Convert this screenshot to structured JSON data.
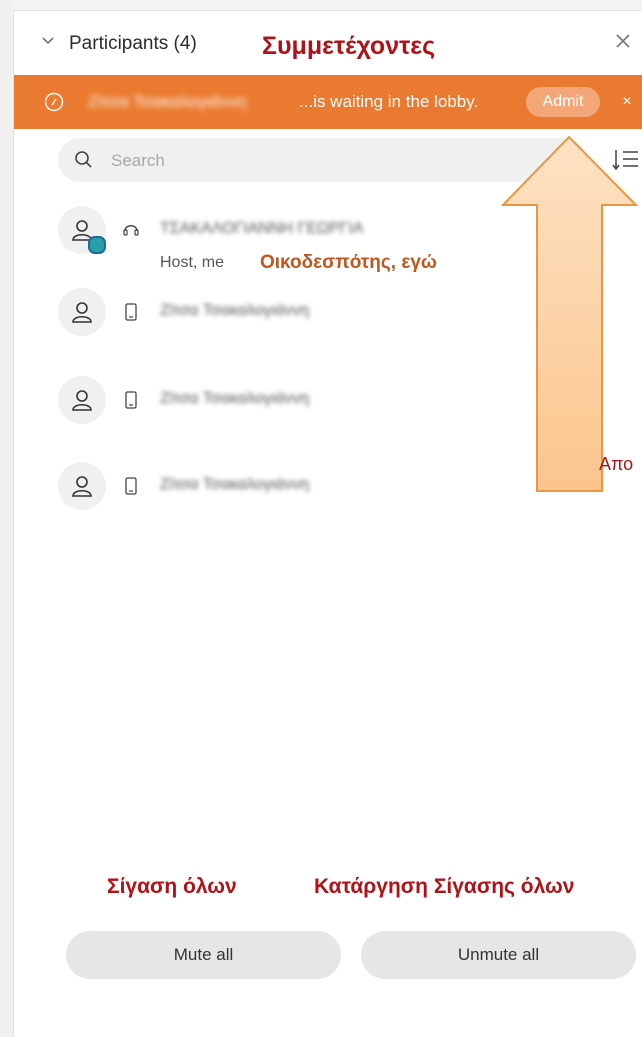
{
  "header": {
    "title": "Participants (4)",
    "greek_title": "Συμμετέχοντες",
    "close_icon": "close-icon",
    "chevron_icon": "chevron-down-icon"
  },
  "lobby": {
    "name": "Ζίτσα Τσακαλογιάννη",
    "message": "...is waiting in the lobby.",
    "admit_label": "Admit",
    "dismiss_label": "×",
    "color": "#ea7a2f"
  },
  "search": {
    "placeholder": "Search",
    "value": ""
  },
  "participants": [
    {
      "name": "ΤΣΑΚΑΛΟΓΙΑΝΝΗ ΓΕΩΡΓΙΑ",
      "role": "Host, me",
      "greek_role": "Οικοδεσπότης, εγώ",
      "device_icon": "headset-icon"
    },
    {
      "name": "Ζίτσα Τσακαλογιάννη",
      "device_icon": "phone-icon"
    },
    {
      "name": "Ζίτσα Τσακαλογιάννη",
      "device_icon": "phone-icon"
    },
    {
      "name": "Ζίτσα Τσακαλογιάννη",
      "device_icon": "phone-icon"
    }
  ],
  "annotation": {
    "arrow_text": "Απο",
    "arrow_fill": "#fbd4ad",
    "arrow_stroke": "#e99743"
  },
  "footer": {
    "mute_all_label": "Mute all",
    "unmute_all_label": "Unmute all",
    "greek_mute": "Σίγαση όλων",
    "greek_unmute": "Κατάργηση Σίγασης όλων"
  }
}
